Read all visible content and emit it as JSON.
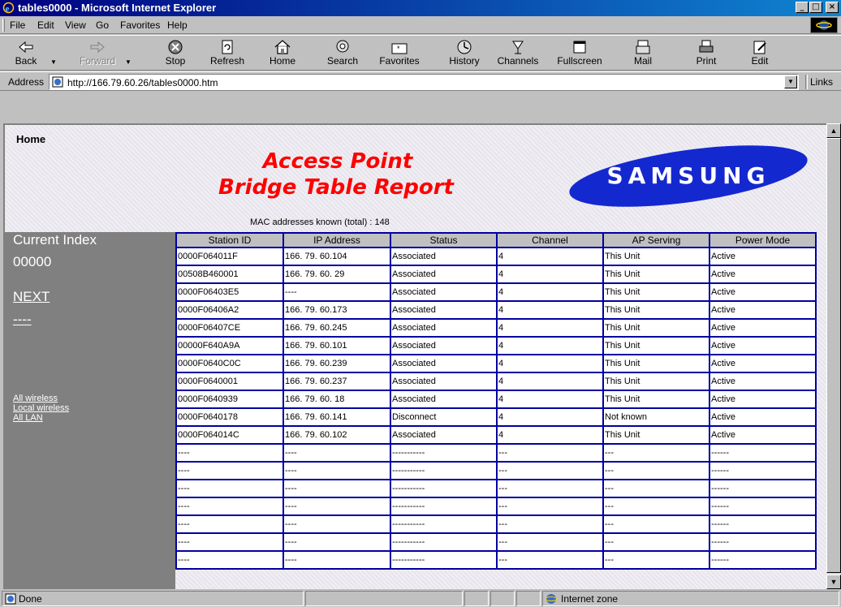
{
  "window": {
    "title": "tables0000 - Microsoft Internet Explorer",
    "minimize": "_",
    "maximize": "□",
    "close": "×"
  },
  "menu": [
    "File",
    "Edit",
    "View",
    "Go",
    "Favorites",
    "Help"
  ],
  "toolbar": {
    "back": "Back",
    "forward": "Forward",
    "stop": "Stop",
    "refresh": "Refresh",
    "home": "Home",
    "search": "Search",
    "favorites": "Favorites",
    "history": "History",
    "channels": "Channels",
    "fullscreen": "Fullscreen",
    "mail": "Mail",
    "print": "Print",
    "edit": "Edit"
  },
  "address": {
    "label": "Address",
    "url": "http://166.79.60.26/tables0000.htm",
    "links": "Links"
  },
  "page": {
    "home": "Home",
    "title_line1": "Access Point",
    "title_line2": "Bridge Table Report",
    "logo_text": "SAMSUNG",
    "mac_known": "MAC addresses known (total) : 148",
    "current_index_label": "Current Index",
    "current_index_value": "00000",
    "next": "NEXT",
    "prev": "----",
    "filters": [
      "All wireless",
      "Local wireless",
      "All LAN"
    ]
  },
  "table": {
    "headers": [
      "Station ID",
      "IP Address",
      "Status",
      "Channel",
      "AP Serving",
      "Power Mode"
    ],
    "rows": [
      [
        "0000F064011F",
        "166. 79. 60.104",
        "Associated",
        "4",
        "This Unit",
        "Active"
      ],
      [
        "00508B460001",
        "166. 79. 60. 29",
        "Associated",
        "4",
        "This Unit",
        "Active"
      ],
      [
        "0000F06403E5",
        "----",
        "Associated",
        "4",
        "This Unit",
        "Active"
      ],
      [
        "0000F06406A2",
        "166. 79. 60.173",
        "Associated",
        "4",
        "This Unit",
        "Active"
      ],
      [
        "0000F06407CE",
        "166. 79. 60.245",
        "Associated",
        "4",
        "This Unit",
        "Active"
      ],
      [
        "00000F640A9A",
        "166. 79. 60.101",
        "Associated",
        "4",
        "This Unit",
        "Active"
      ],
      [
        "0000F0640C0C",
        "166. 79. 60.239",
        "Associated",
        "4",
        "This Unit",
        "Active"
      ],
      [
        "0000F0640001",
        "166. 79. 60.237",
        "Associated",
        "4",
        "This Unit",
        "Active"
      ],
      [
        "0000F0640939",
        "166. 79. 60. 18",
        "Associated",
        "4",
        "This Unit",
        "Active"
      ],
      [
        "0000F0640178",
        "166. 79. 60.141",
        "Disconnect",
        "4",
        "Not known",
        "Active"
      ],
      [
        "0000F064014C",
        "166. 79. 60.102",
        "Associated",
        "4",
        "This Unit",
        "Active"
      ],
      [
        "----",
        "----",
        "-----------",
        "---",
        "---",
        "------"
      ],
      [
        "----",
        "----",
        "-----------",
        "---",
        "---",
        "------"
      ],
      [
        "----",
        "----",
        "-----------",
        "---",
        "---",
        "------"
      ],
      [
        "----",
        "----",
        "-----------",
        "---",
        "---",
        "------"
      ],
      [
        "----",
        "----",
        "-----------",
        "---",
        "---",
        "------"
      ],
      [
        "----",
        "----",
        "-----------",
        "---",
        "---",
        "------"
      ],
      [
        "----",
        "----",
        "-----------",
        "---",
        "---",
        "------"
      ]
    ]
  },
  "status": {
    "text": "Done",
    "zone": "Internet zone"
  }
}
